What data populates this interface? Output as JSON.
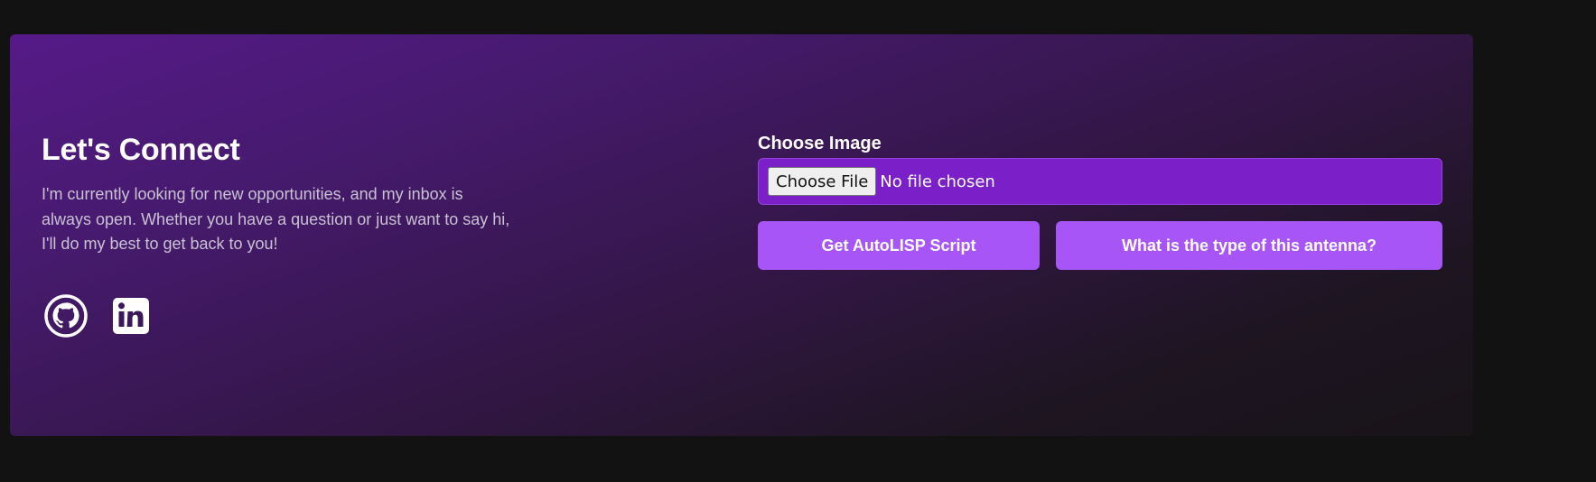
{
  "contact": {
    "title": "Let's Connect",
    "description": "I'm currently looking for new opportunities, and my inbox is always open. Whether you have a question or just want to say hi, I'll do my best to get back to you!",
    "socials": [
      {
        "icon": "github-icon"
      },
      {
        "icon": "linkedin-icon"
      }
    ]
  },
  "form": {
    "label": "Choose Image",
    "file_button_label": "Choose File",
    "file_status": "No file chosen",
    "buttons": [
      {
        "label": "Get AutoLISP Script"
      },
      {
        "label": "What is the type of this antenna?"
      }
    ]
  },
  "colors": {
    "page_background": "#121212",
    "card_gradient_start": "#561a88",
    "card_gradient_end": "#181418",
    "file_box": "#7b20c9",
    "button": "#a855f7",
    "text": "#ffffff",
    "muted_text": "#c9c2d3"
  }
}
